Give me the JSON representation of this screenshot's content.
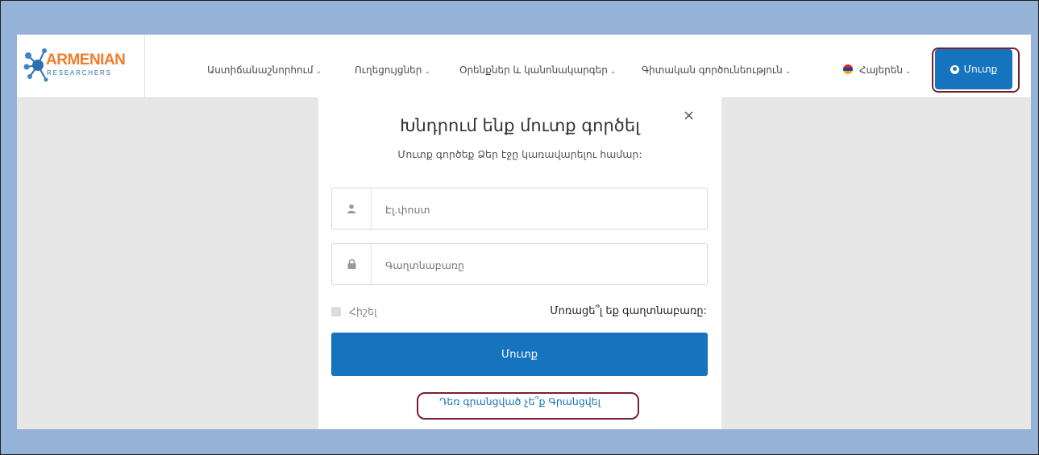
{
  "logo": {
    "word": "ARMENIAN",
    "sub": "RESEARCHERS"
  },
  "nav": {
    "items": [
      {
        "label": "Աստիճանաշնորհում"
      },
      {
        "label": "Ուղեցույցներ"
      },
      {
        "label": "Օրենքներ և կանոնակարգեր"
      },
      {
        "label": "Գիտական գործունեություն"
      }
    ],
    "language": "Հայերեն",
    "login_label": "Մուտք"
  },
  "modal": {
    "close_symbol": "×",
    "title": "Խնդրում ենք մուտք գործել",
    "subtitle": "Մուտք գործեք Ձեր էջը կառավարելու համար:",
    "email_placeholder": "Էլ.փոստ",
    "password_placeholder": "Գաղտնաբառը",
    "remember_label": "Հիշել",
    "forgot_label": "Մոռացե՞լ եք գաղտնաբառը:",
    "submit_label": "Մուտք",
    "register_prompt": "Դեռ գրանցված չե՞ք",
    "register_link": "Գրանցվել"
  },
  "colors": {
    "primary": "#1673be",
    "logo_orange": "#f07c2b",
    "highlight": "#7a1e2e",
    "outer_bg": "#95b3d7"
  },
  "icons": {
    "logo": "molecule-logo-icon",
    "caret": "chevron-down-icon",
    "flag": "armenian-flag-icon",
    "login": "user-circle-icon",
    "email": "user-icon",
    "password": "lock-icon",
    "close": "close-icon"
  }
}
